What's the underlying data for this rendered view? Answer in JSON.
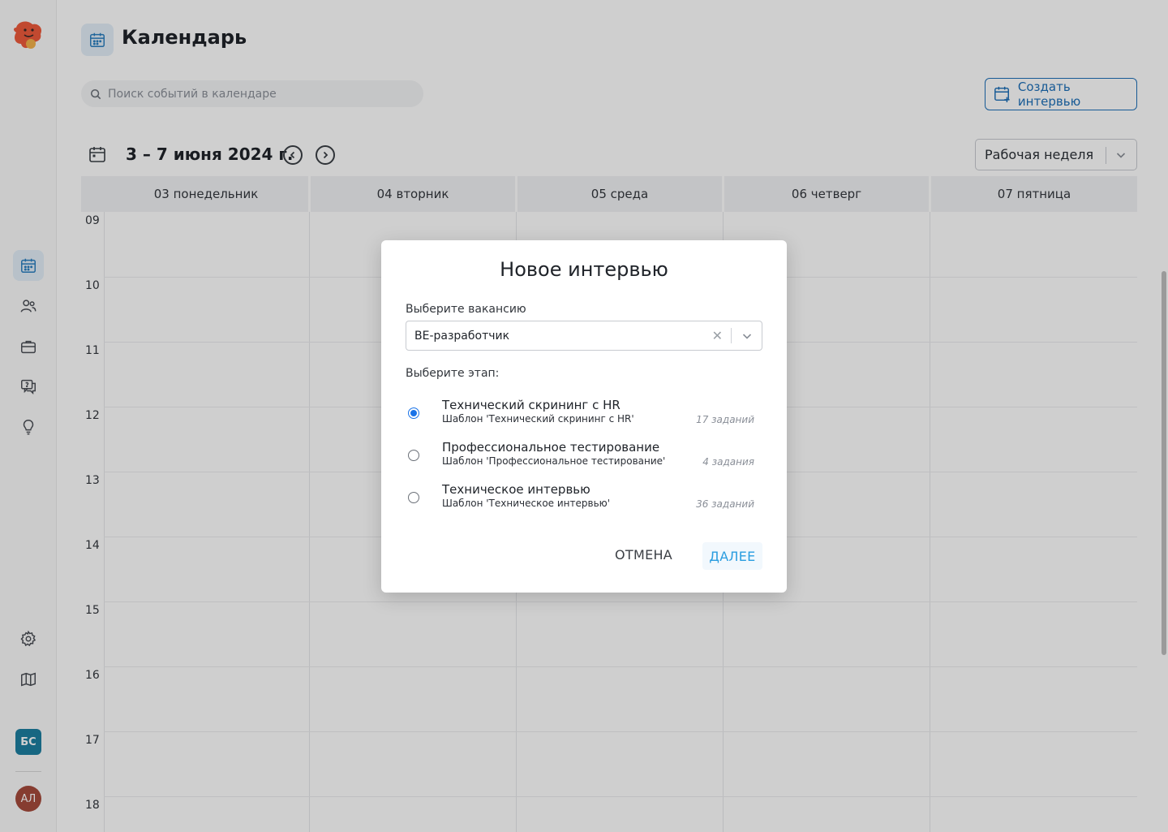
{
  "page": {
    "title": "Календарь"
  },
  "search": {
    "placeholder": "Поиск событий в календаре"
  },
  "create_button": {
    "label": "Создать интервью"
  },
  "toolbar": {
    "date_range": "3 – 7 июня 2024 г.",
    "view_selected": "Рабочая неделя"
  },
  "calendar": {
    "days": [
      "03 понедельник",
      "04 вторник",
      "05 среда",
      "06 четверг",
      "07 пятница"
    ],
    "hours": [
      "09",
      "10",
      "11",
      "12",
      "13",
      "14",
      "15",
      "16",
      "17",
      "18"
    ]
  },
  "sidebar": {
    "items": [
      {
        "icon": "calendar-icon",
        "active": true
      },
      {
        "icon": "users-icon",
        "active": false
      },
      {
        "icon": "briefcase-icon",
        "active": false
      },
      {
        "icon": "questions-icon",
        "active": false
      },
      {
        "icon": "lightbulb-icon",
        "active": false
      }
    ],
    "bottom_items": [
      {
        "icon": "gear-icon"
      },
      {
        "icon": "map-icon"
      }
    ],
    "workspace_badge": "БС",
    "user_avatar": "АЛ"
  },
  "modal": {
    "title": "Новое интервью",
    "vacancy_label": "Выберите вакансию",
    "vacancy_value": "BE-разработчик",
    "stage_label": "Выберите этап:",
    "stages": [
      {
        "name": "Технический скрининг с HR",
        "template": "Шаблон 'Технический скрининг с HR'",
        "count": "17 заданий",
        "selected": true
      },
      {
        "name": "Профессиональное тестирование",
        "template": "Шаблон 'Профессиональное тестирование'",
        "count": "4 задания",
        "selected": false
      },
      {
        "name": "Техническое интервью",
        "template": "Шаблон 'Техническое интервью'",
        "count": "36 заданий",
        "selected": false
      }
    ],
    "cancel_label": "ОТМЕНА",
    "next_label": "ДАЛЕЕ"
  },
  "colors": {
    "accent": "#1d6fb8",
    "radio_selected": "#1a73e8",
    "next_button_text": "#2a9de0",
    "workspace_badge_bg": "#1d7fa1",
    "avatar_bg": "#a64a3c"
  }
}
